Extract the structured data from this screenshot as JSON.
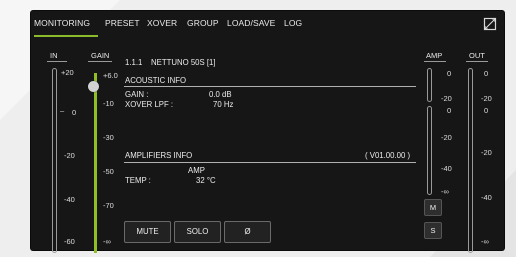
{
  "tabs": [
    {
      "label": "MONITORING"
    },
    {
      "label": "PRESET"
    },
    {
      "label": "XOVER"
    },
    {
      "label": "GROUP"
    },
    {
      "label": "LOAD/SAVE"
    },
    {
      "label": "LOG"
    }
  ],
  "active_tab": "MONITORING",
  "meters": {
    "in": {
      "title": "IN",
      "scale": [
        "+20",
        "0",
        "-20",
        "-40",
        "-60"
      ],
      "marker": "–"
    },
    "gain": {
      "title": "GAIN",
      "scale": [
        "+6.0",
        "-10",
        "-30",
        "-50",
        "-70",
        "-∞"
      ],
      "level": 0.9
    },
    "amp": {
      "title": "AMP",
      "scale_top": [
        "0",
        "-20"
      ],
      "scale_bottom": [
        "0",
        "-20",
        "-40",
        "-∞"
      ]
    },
    "out": {
      "title": "OUT",
      "scale": [
        "0",
        "-20",
        "0",
        "-20",
        "-40",
        "-∞"
      ]
    }
  },
  "device": {
    "id": "1.1.1",
    "name": "NETTUNO 50S [1]"
  },
  "acoustic": {
    "title": "ACOUSTIC INFO",
    "gain_label": "GAIN :",
    "gain_value": "0.0 dB",
    "lpf_label": "XOVER LPF :",
    "lpf_value": "70 Hz"
  },
  "amplifiers": {
    "title": "AMPLIFIERS INFO",
    "version": "( V01.00.00 )",
    "col_header": "AMP",
    "temp_label": "TEMP :",
    "temp_value": "32  °C"
  },
  "buttons": {
    "mute": "MUTE",
    "solo": "SOLO",
    "phase": "Ø",
    "m": "M",
    "s": "S"
  },
  "colors": {
    "accent": "#8bbb2a",
    "panel": "#161616"
  }
}
